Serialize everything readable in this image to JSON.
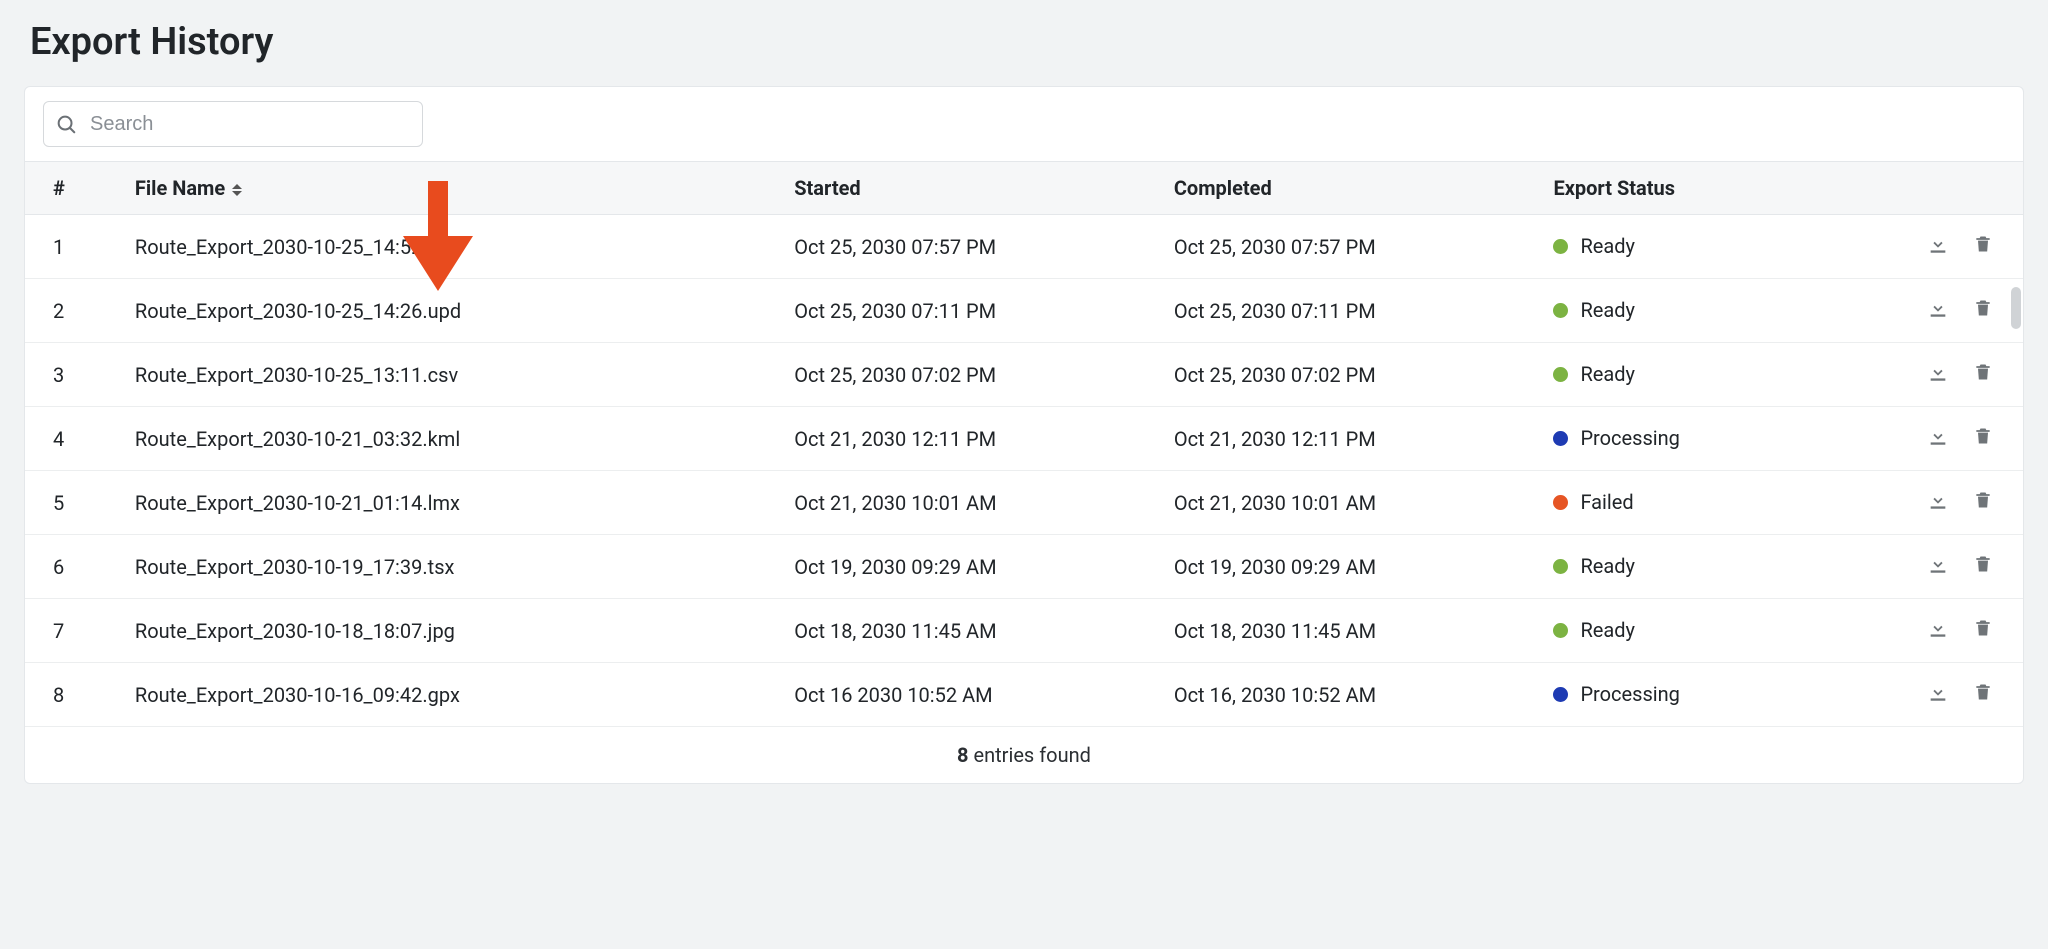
{
  "page": {
    "title": "Export History"
  },
  "search": {
    "placeholder": "Search",
    "value": ""
  },
  "columns": {
    "num": "#",
    "file": "File Name",
    "started": "Started",
    "completed": "Completed",
    "status": "Export Status"
  },
  "status_labels": {
    "ready": "Ready",
    "processing": "Processing",
    "failed": "Failed"
  },
  "rows": [
    {
      "n": "1",
      "file": "Route_Export_2030-10-25_14:52.xml",
      "started": "Oct 25, 2030 07:57 PM",
      "completed": "Oct 25, 2030 07:57 PM",
      "status": "ready"
    },
    {
      "n": "2",
      "file": "Route_Export_2030-10-25_14:26.upd",
      "started": "Oct 25, 2030 07:11 PM",
      "completed": "Oct 25, 2030 07:11 PM",
      "status": "ready"
    },
    {
      "n": "3",
      "file": "Route_Export_2030-10-25_13:11.csv",
      "started": "Oct 25, 2030 07:02 PM",
      "completed": "Oct 25, 2030 07:02 PM",
      "status": "ready"
    },
    {
      "n": "4",
      "file": "Route_Export_2030-10-21_03:32.kml",
      "started": "Oct 21, 2030 12:11 PM",
      "completed": "Oct 21, 2030 12:11 PM",
      "status": "processing"
    },
    {
      "n": "5",
      "file": "Route_Export_2030-10-21_01:14.lmx",
      "started": "Oct 21, 2030 10:01 AM",
      "completed": "Oct 21, 2030 10:01 AM",
      "status": "failed"
    },
    {
      "n": "6",
      "file": "Route_Export_2030-10-19_17:39.tsx",
      "started": "Oct 19, 2030 09:29 AM",
      "completed": "Oct 19, 2030 09:29 AM",
      "status": "ready"
    },
    {
      "n": "7",
      "file": "Route_Export_2030-10-18_18:07.jpg",
      "started": "Oct 18, 2030 11:45 AM",
      "completed": "Oct 18, 2030 11:45 AM",
      "status": "ready"
    },
    {
      "n": "8",
      "file": "Route_Export_2030-10-16_09:42.gpx",
      "started": "Oct 16 2030 10:52 AM",
      "completed": "Oct 16, 2030 10:52 AM",
      "status": "processing"
    }
  ],
  "footer": {
    "count": "8",
    "suffix": " entries found"
  },
  "colors": {
    "ready": "#7cb342",
    "processing": "#1e3bb3",
    "failed": "#e65524",
    "annotation_arrow": "#e84b1e"
  }
}
